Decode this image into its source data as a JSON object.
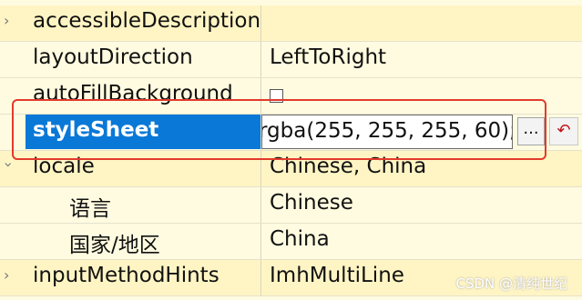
{
  "properties": [
    {
      "name": "accessibleDescription",
      "value": "",
      "expandable": true,
      "expanded": false
    },
    {
      "name": "layoutDirection",
      "value": "LeftToRight"
    },
    {
      "name": "autoFillBackground",
      "value": "",
      "checkbox": true,
      "checked": false
    },
    {
      "name": "styleSheet",
      "value": "rgba(255, 255, 255, 60);",
      "selected": true,
      "editing": true
    },
    {
      "name": "locale",
      "value": "Chinese, China",
      "expandable": true,
      "expanded": true
    },
    {
      "name": "语言",
      "value": "Chinese",
      "indent": 1
    },
    {
      "name": "国家/地区",
      "value": "China",
      "indent": 1
    },
    {
      "name": "inputMethodHints",
      "value": "ImhMultiLine",
      "expandable": true,
      "expanded": false
    }
  ],
  "editor_buttons": {
    "more_label": "...",
    "reset_icon": "reset-arrow-icon"
  },
  "annotation": {
    "color": "#e23a2c"
  },
  "watermark": "CSDN @清纯世纪",
  "colors": {
    "selection": "#0a78d7",
    "row_even": "#fff5c4",
    "row_odd": "#fffbe0"
  }
}
